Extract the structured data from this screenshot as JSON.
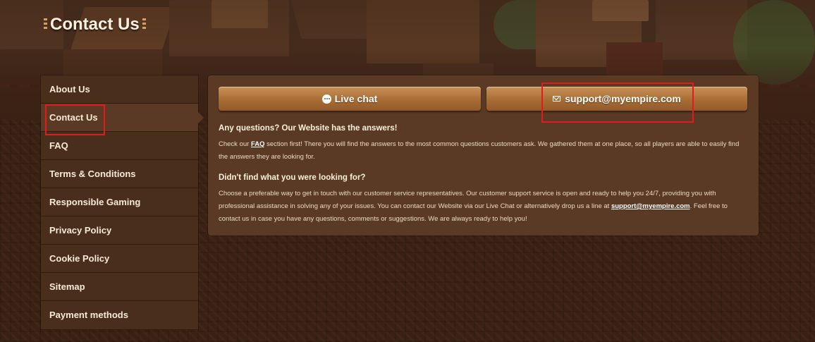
{
  "page": {
    "title": "Contact Us"
  },
  "sidebar": {
    "items": [
      {
        "label": "About Us"
      },
      {
        "label": "Contact Us"
      },
      {
        "label": "FAQ"
      },
      {
        "label": "Terms & Conditions"
      },
      {
        "label": "Responsible Gaming"
      },
      {
        "label": "Privacy Policy"
      },
      {
        "label": "Cookie Policy"
      },
      {
        "label": "Sitemap"
      },
      {
        "label": "Payment methods"
      }
    ],
    "active_index": 1
  },
  "buttons": {
    "live_chat_label": "Live chat",
    "live_chat_icon": "chat-bubble-icon",
    "email_label": "support@myempire.com",
    "email_icon": "envelope-icon"
  },
  "content": {
    "section1_title": "Any questions? Our Website has the answers!",
    "section1_pre": "Check our ",
    "section1_link": "FAQ",
    "section1_post": " section first! There you will find the answers to the most common questions customers ask. We gathered them at one place, so all players are able to easily find the answers they are looking for.",
    "section2_title": "Didn't find what you were looking for?",
    "section2_pre": "Choose a preferable way to get in touch with our customer service representatives. Our customer support service is open and ready to help you 24/7, providing you with professional assistance in solving any of your issues. You can contact our Website via our Live Chat or alternatively drop us a line at ",
    "section2_link": "support@myempire.com",
    "section2_post": ". Feel free to contact us in case you have any questions, comments or suggestions. We are always ready to help you!"
  },
  "colors": {
    "background": "#3a2114",
    "panel": "#5a3a25",
    "button": "#a86d34",
    "highlight": "#e31b1b"
  }
}
